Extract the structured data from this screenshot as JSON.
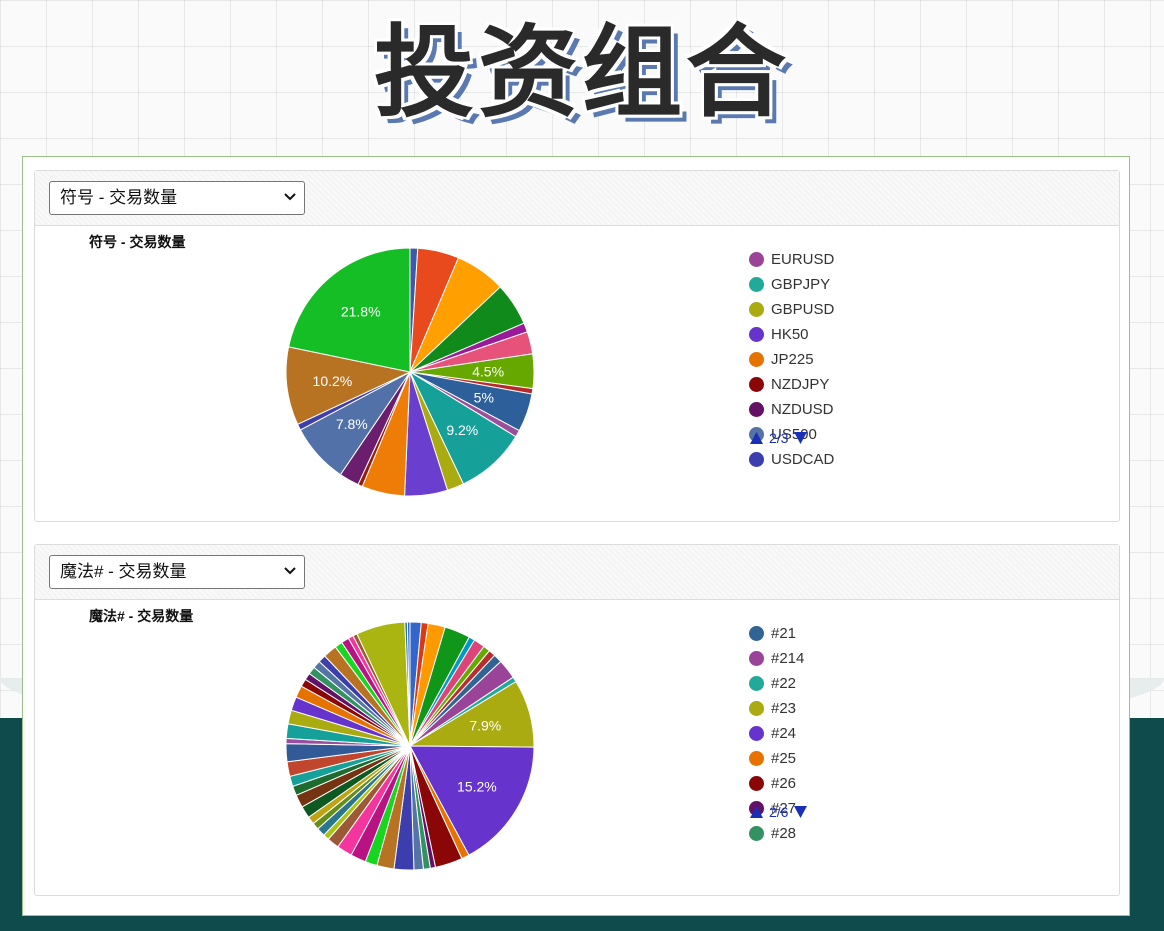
{
  "page": {
    "title": "投资组合"
  },
  "charts": [
    {
      "select_value": "符号 - 交易数量",
      "pager": "2/3",
      "chart_data": {
        "type": "pie",
        "title": "符号 - 交易数量",
        "slices": [
          {
            "label": "",
            "value": 1.0,
            "color": "#3d5aa8"
          },
          {
            "label": "",
            "value": 5.4,
            "color": "#e8491d"
          },
          {
            "label": "",
            "value": 6.6,
            "color": "#ff9f00"
          },
          {
            "label": "",
            "value": 5.6,
            "color": "#108a1a"
          },
          {
            "label": "",
            "value": 1.2,
            "color": "#9a1a9a"
          },
          {
            "label": "",
            "value": 2.9,
            "color": "#e6527a"
          },
          {
            "label": "",
            "value": 4.5,
            "color": "#66a800",
            "text": "4.5%"
          },
          {
            "label": "",
            "value": 0.7,
            "color": "#b82a2a"
          },
          {
            "label": "",
            "value": 5.0,
            "color": "#2d5f9a",
            "text": "5%"
          },
          {
            "label": "",
            "value": 0.9,
            "color": "#9a4f9e"
          },
          {
            "label": "",
            "value": 9.2,
            "color": "#16a09a",
            "text": "9.2%"
          },
          {
            "label": "",
            "value": 2.2,
            "color": "#aaaa11"
          },
          {
            "label": "",
            "value": 5.6,
            "color": "#6a3fcf"
          },
          {
            "label": "",
            "value": 5.6,
            "color": "#ee7d07"
          },
          {
            "label": "",
            "value": 0.6,
            "color": "#951d0d"
          },
          {
            "label": "",
            "value": 2.6,
            "color": "#6b1e6e"
          },
          {
            "label": "",
            "value": 7.8,
            "color": "#5271a8",
            "text": "7.8%"
          },
          {
            "label": "",
            "value": 0.8,
            "color": "#3b3eac"
          },
          {
            "label": "",
            "value": 10.2,
            "color": "#b77322",
            "text": "10.2%"
          },
          {
            "label": "",
            "value": 21.8,
            "color": "#16be26",
            "text": "21.8%"
          }
        ]
      },
      "legend": [
        {
          "label": "EURUSD",
          "color": "#994499"
        },
        {
          "label": "GBPJPY",
          "color": "#22aa99"
        },
        {
          "label": "GBPUSD",
          "color": "#aaaa11"
        },
        {
          "label": "HK50",
          "color": "#6633cc"
        },
        {
          "label": "JP225",
          "color": "#e67300"
        },
        {
          "label": "NZDJPY",
          "color": "#8b0707"
        },
        {
          "label": "NZDUSD",
          "color": "#651067"
        },
        {
          "label": "US500",
          "color": "#5574a6"
        },
        {
          "label": "USDCAD",
          "color": "#3b3eac"
        }
      ]
    },
    {
      "select_value": "魔法# - 交易数量",
      "pager": "2/6",
      "chart_data": {
        "type": "pie",
        "title": "魔法# - 交易数量",
        "slices": [
          {
            "label": "",
            "value": 1.3,
            "color": "#3366cc"
          },
          {
            "label": "",
            "value": 0.8,
            "color": "#dc3912"
          },
          {
            "label": "",
            "value": 2.0,
            "color": "#ff9900"
          },
          {
            "label": "",
            "value": 3.0,
            "color": "#109618"
          },
          {
            "label": "",
            "value": 0.7,
            "color": "#0099c6"
          },
          {
            "label": "",
            "value": 1.3,
            "color": "#dd4477"
          },
          {
            "label": "",
            "value": 0.8,
            "color": "#66aa00"
          },
          {
            "label": "",
            "value": 0.8,
            "color": "#b82e2e"
          },
          {
            "label": "",
            "value": 1.0,
            "color": "#316395"
          },
          {
            "label": "",
            "value": 2.3,
            "color": "#994499"
          },
          {
            "label": "",
            "value": 0.6,
            "color": "#22aa99"
          },
          {
            "label": "",
            "value": 7.9,
            "color": "#aaaa11",
            "text": "7.9%"
          },
          {
            "label": "",
            "value": 15.2,
            "color": "#6633cc",
            "text": "15.2%"
          },
          {
            "label": "",
            "value": 0.9,
            "color": "#e67300"
          },
          {
            "label": "",
            "value": 3.2,
            "color": "#8b0707"
          },
          {
            "label": "",
            "value": 0.6,
            "color": "#651067"
          },
          {
            "label": "",
            "value": 0.8,
            "color": "#329262"
          },
          {
            "label": "",
            "value": 1.1,
            "color": "#5574a6"
          },
          {
            "label": "",
            "value": 2.3,
            "color": "#3b3eac"
          },
          {
            "label": "",
            "value": 2.0,
            "color": "#b77322"
          },
          {
            "label": "",
            "value": 1.4,
            "color": "#16d620"
          },
          {
            "label": "",
            "value": 1.8,
            "color": "#b91383"
          },
          {
            "label": "",
            "value": 1.8,
            "color": "#f4359e"
          },
          {
            "label": "",
            "value": 1.4,
            "color": "#9c5935"
          },
          {
            "label": "",
            "value": 0.7,
            "color": "#a9c413"
          },
          {
            "label": "",
            "value": 1.0,
            "color": "#2a778d"
          },
          {
            "label": "",
            "value": 0.8,
            "color": "#668d1c"
          },
          {
            "label": "",
            "value": 0.9,
            "color": "#bea413"
          },
          {
            "label": "",
            "value": 1.4,
            "color": "#0c5922"
          },
          {
            "label": "",
            "value": 1.5,
            "color": "#743411"
          },
          {
            "label": "",
            "value": 1.1,
            "color": "#1d6b2e"
          },
          {
            "label": "",
            "value": 1.2,
            "color": "#16a09a"
          },
          {
            "label": "",
            "value": 1.7,
            "color": "#c2452d"
          },
          {
            "label": "",
            "value": 2.1,
            "color": "#315a96"
          },
          {
            "label": "",
            "value": 0.6,
            "color": "#9a4f9e"
          },
          {
            "label": "",
            "value": 1.7,
            "color": "#16a09a"
          },
          {
            "label": "",
            "value": 1.6,
            "color": "#aaaa11"
          },
          {
            "label": "",
            "value": 1.6,
            "color": "#6633cc"
          },
          {
            "label": "",
            "value": 1.4,
            "color": "#e67300"
          },
          {
            "label": "",
            "value": 0.9,
            "color": "#8b0707"
          },
          {
            "label": "",
            "value": 0.8,
            "color": "#651067"
          },
          {
            "label": "",
            "value": 0.9,
            "color": "#329262"
          },
          {
            "label": "",
            "value": 0.9,
            "color": "#5574a6"
          },
          {
            "label": "",
            "value": 0.9,
            "color": "#3b3eac"
          },
          {
            "label": "",
            "value": 1.6,
            "color": "#b77322"
          },
          {
            "label": "",
            "value": 0.9,
            "color": "#16d620"
          },
          {
            "label": "",
            "value": 0.9,
            "color": "#b91383"
          },
          {
            "label": "",
            "value": 0.6,
            "color": "#f4359e"
          },
          {
            "label": "",
            "value": 0.5,
            "color": "#9c5935"
          },
          {
            "label": "",
            "value": 5.7,
            "color": "#aab511"
          },
          {
            "label": "",
            "value": 0.3,
            "color": "#2a778d"
          },
          {
            "label": "",
            "value": 0.3,
            "color": "#3366cc"
          }
        ]
      },
      "legend": [
        {
          "label": "#21",
          "color": "#316395"
        },
        {
          "label": "#214",
          "color": "#994499"
        },
        {
          "label": "#22",
          "color": "#22aa99"
        },
        {
          "label": "#23",
          "color": "#aaaa11"
        },
        {
          "label": "#24",
          "color": "#6633cc"
        },
        {
          "label": "#25",
          "color": "#e67300"
        },
        {
          "label": "#26",
          "color": "#8b0707"
        },
        {
          "label": "#27",
          "color": "#651067"
        },
        {
          "label": "#28",
          "color": "#329262"
        }
      ]
    }
  ]
}
